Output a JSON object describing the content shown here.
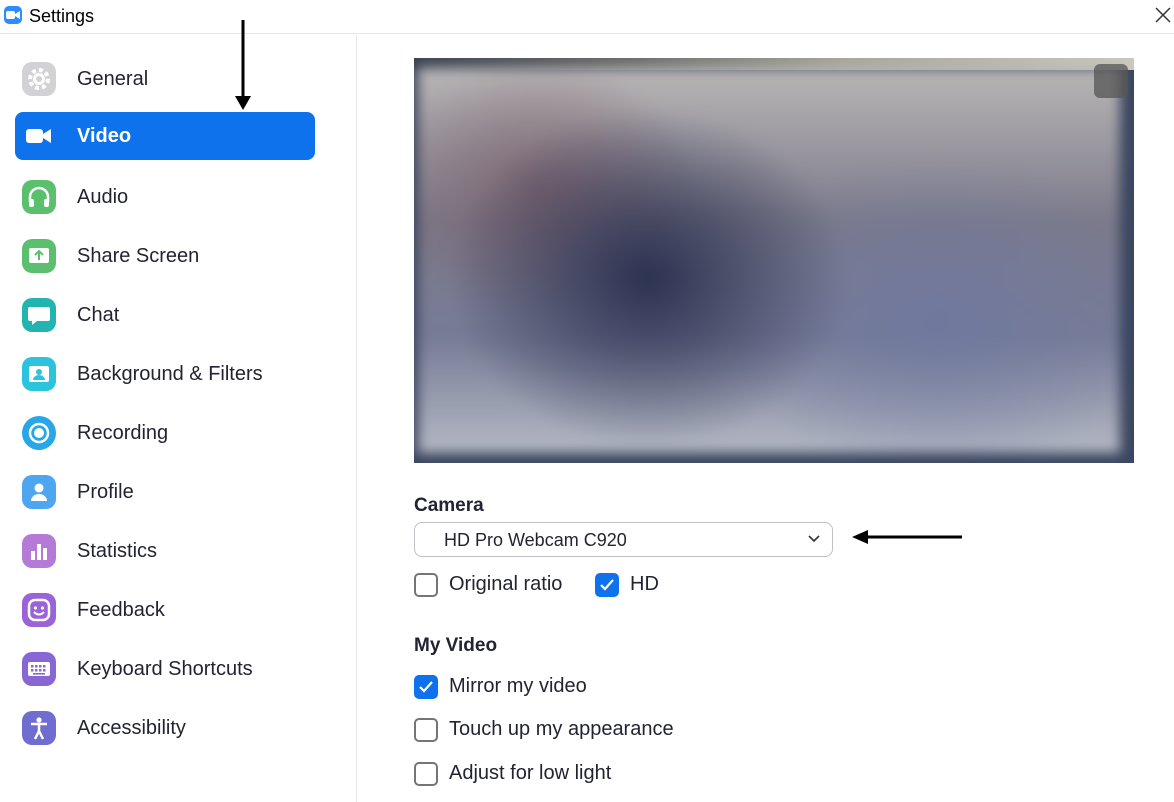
{
  "window": {
    "title": "Settings"
  },
  "sidebar": {
    "items": [
      {
        "label": "General",
        "icon": "gear-icon",
        "color": "#d2d2d6"
      },
      {
        "label": "Video",
        "icon": "video-camera-icon",
        "color": "#0e72ed",
        "active": true
      },
      {
        "label": "Audio",
        "icon": "headphones-icon",
        "color": "#5bc06e"
      },
      {
        "label": "Share Screen",
        "icon": "share-screen-icon",
        "color": "#5bc06e"
      },
      {
        "label": "Chat",
        "icon": "chat-bubble-icon",
        "color": "#22b5b0"
      },
      {
        "label": "Background & Filters",
        "icon": "background-person-icon",
        "color": "#2bc3de"
      },
      {
        "label": "Recording",
        "icon": "record-icon",
        "color": "#27a6e8"
      },
      {
        "label": "Profile",
        "icon": "user-icon",
        "color": "#4ea5f0"
      },
      {
        "label": "Statistics",
        "icon": "bar-chart-icon",
        "color": "#b57ad8"
      },
      {
        "label": "Feedback",
        "icon": "smiley-icon",
        "color": "#9a63d6"
      },
      {
        "label": "Keyboard Shortcuts",
        "icon": "keyboard-icon",
        "color": "#8767d3"
      },
      {
        "label": "Accessibility",
        "icon": "accessibility-icon",
        "color": "#6f6dcf"
      }
    ]
  },
  "video": {
    "camera_label": "Camera",
    "camera_value": "HD Pro Webcam C920",
    "options": [
      {
        "label": "Original ratio",
        "checked": false
      },
      {
        "label": "HD",
        "checked": true
      }
    ],
    "my_video_label": "My Video",
    "my_video_options": [
      {
        "label": "Mirror my video",
        "checked": true
      },
      {
        "label": "Touch up my appearance",
        "checked": false
      },
      {
        "label": "Adjust for low light",
        "checked": false
      }
    ]
  },
  "colors": {
    "accent": "#0e72ed",
    "text": "#232333"
  }
}
